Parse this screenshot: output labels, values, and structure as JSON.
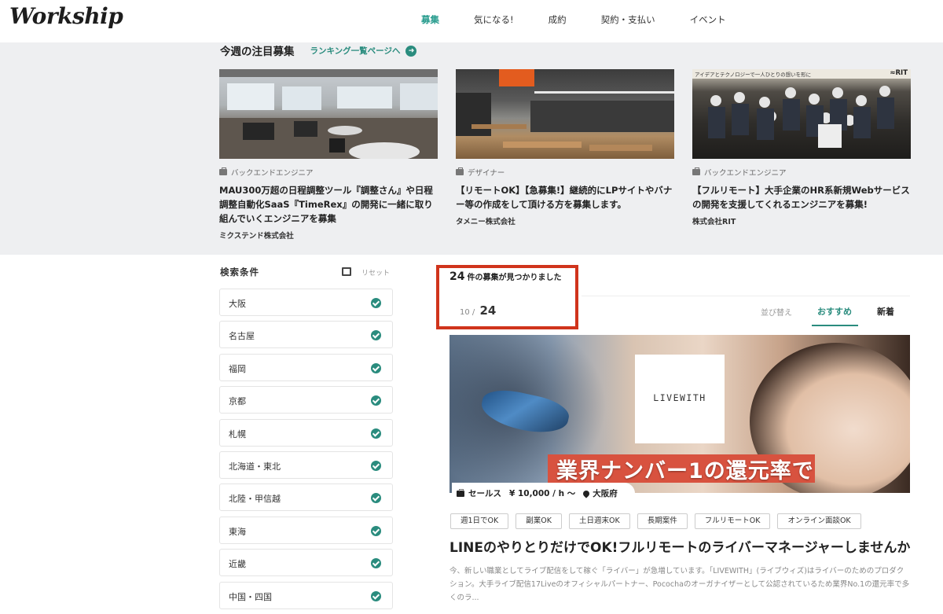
{
  "header": {
    "logo": "Workship",
    "nav": [
      "募集",
      "気になる!",
      "成約",
      "契約・支払い",
      "イベント"
    ],
    "active_index": 0
  },
  "featured": {
    "title": "今週の注目募集",
    "link": "ランキング一覧ページへ",
    "cards": [
      {
        "category": "バックエンドエンジニア",
        "title": "MAU300万超の日程調整ツール『調整さん』や日程調整自動化SaaS『TimeRex』の開発に一緒に取り組んでいくエンジニアを募集",
        "company": "ミクステンド株式会社"
      },
      {
        "category": "デザイナー",
        "title": "【リモートOK】【急募集!】継続的にLPサイトやバナー等の作成をして頂ける方を募集します。",
        "company": "タメニー株式会社"
      },
      {
        "category": "バックエンドエンジニア",
        "title": "【フルリモート】大手企業のHR系新規Webサービスの開発を支援してくれるエンジニアを募集!",
        "company": "株式会社RIT",
        "image_caption": "アイデアとテクノロジーで一人ひとりの想いを形に",
        "image_logo": "≈RIT"
      }
    ]
  },
  "search": {
    "title": "検索条件",
    "reset": "リセット",
    "filters": [
      "大阪",
      "名古屋",
      "福岡",
      "京都",
      "札幌",
      "北海道・東北",
      "北陸・甲信越",
      "東海",
      "近畿",
      "中国・四国"
    ]
  },
  "results": {
    "count": "24",
    "count_suffix": "件の募集が見つかりました",
    "page_current": "10",
    "page_sep": "/",
    "page_total": "24",
    "sort_label": "並び替え",
    "tab_recommended": "おすすめ",
    "tab_new": "新着"
  },
  "job": {
    "logo_text": "LIVEWITH",
    "banner_text": "業界ナンバー1の還元率で",
    "category": "セールス",
    "rate": "¥ 10,000 / h 〜",
    "location": "大阪府",
    "tags": [
      "週1日でOK",
      "副業OK",
      "土日週末OK",
      "長期案件",
      "フルリモートOK",
      "オンライン面談OK"
    ],
    "title": "LINEのやりとりだけでOK!フルリモートのライバーマネージャーしませんか",
    "description": "今、新しい職業としてライブ配信をして稼ぐ「ライバー」が急増しています。「LIVEWITH」(ライブウィズ)はライバーのためのプロダクション。大手ライブ配信17Liveのオフィシャルパートナー、Pocochaのオーガナイザーとして公認されているため業界No.1の還元率で多くのラ..."
  },
  "colors": {
    "accent": "#2a8c7e",
    "highlight_box": "#d0341c"
  }
}
